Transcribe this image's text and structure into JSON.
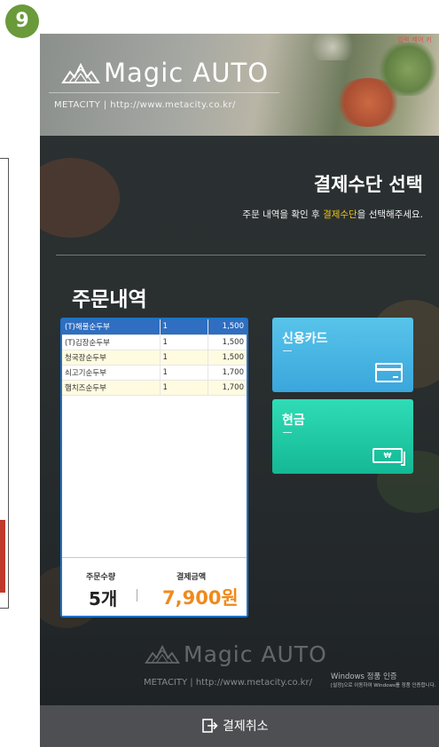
{
  "step_number": "9",
  "header": {
    "logo_text": "Magic AUTO",
    "url_text": "METACITY  |  http://www.metacity.co.kr/",
    "corner_note": "입력 제어 키"
  },
  "selection": {
    "title": "결제수단 선택",
    "instruction_prefix": "주문 내역을 확인 후 ",
    "instruction_highlight": "결제수단",
    "instruction_suffix": "을 선택해주세요."
  },
  "order": {
    "title": "주문내역",
    "items": [
      {
        "name": "(T)해물순두부",
        "qty": "1",
        "price": "1,500"
      },
      {
        "name": "(T)김장순두부",
        "qty": "1",
        "price": "1,500"
      },
      {
        "name": "청국장순두부",
        "qty": "1",
        "price": "1,500"
      },
      {
        "name": "쇠고기순두부",
        "qty": "1",
        "price": "1,700"
      },
      {
        "name": "햄치즈순두부",
        "qty": "1",
        "price": "1,700"
      }
    ],
    "summary": {
      "qty_label": "주문수량",
      "amount_label": "결제금액",
      "qty_value": "5개",
      "amount_value": "7,900원"
    }
  },
  "payment": {
    "card_label": "신용카드",
    "cash_label": "현금",
    "cash_symbol": "₩"
  },
  "footer": {
    "logo_text": "Magic AUTO",
    "url_text": "METACITY  |  http://www.metacity.co.kr/",
    "cancel_label": "결제취소"
  },
  "windows_notice": {
    "line1": "Windows 정품 인증",
    "line2": "[설정]으로 이동하여 Windows를 정품 인증합니다."
  },
  "colors": {
    "card": "#3aa6dc",
    "cash": "#14b895",
    "highlight": "#f0c419",
    "amount": "#f08a1c",
    "selected_row": "#2f6ec0"
  }
}
